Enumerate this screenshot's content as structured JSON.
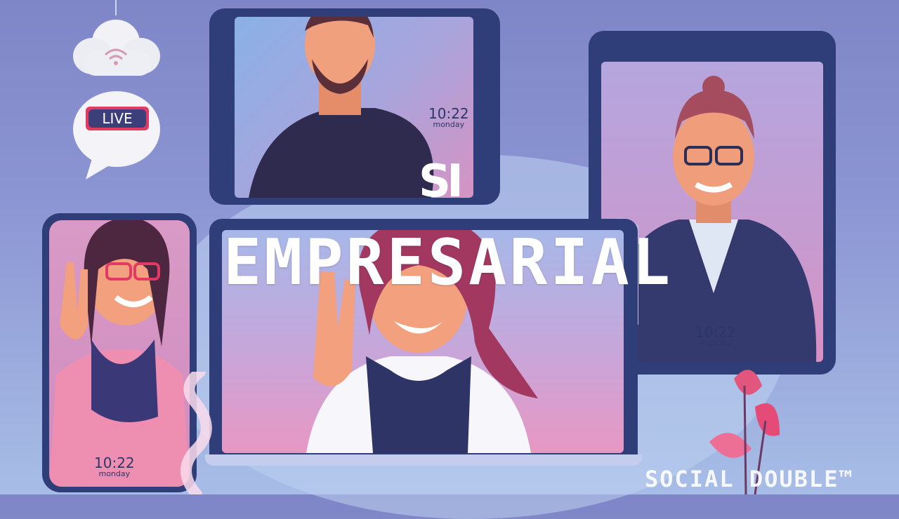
{
  "overlay": {
    "logo_mark": "SI",
    "headline": "EMPRESARIAL",
    "watermark": "SOCIAL DOUBLE™"
  },
  "badges": {
    "live": "LIVE"
  },
  "clocks": [
    {
      "time": "10:22",
      "day": "monday"
    },
    {
      "time": "10:22",
      "day": "monday"
    },
    {
      "time": "10:22",
      "day": "monday"
    }
  ],
  "colors": {
    "background": "#8c95d3",
    "device_frame": "#2f3d79",
    "screen_pink": "#e3a0c4",
    "screen_blue": "#7fa0dc",
    "live_red": "#e23a63"
  }
}
